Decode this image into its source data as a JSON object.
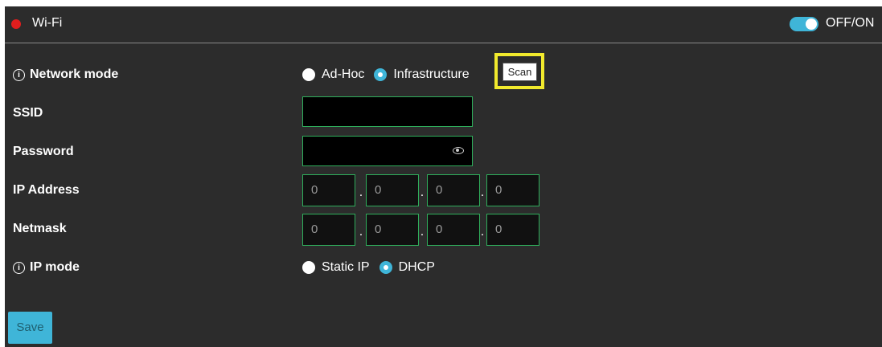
{
  "header": {
    "title": "Wi-Fi",
    "toggle_label": "OFF/ON",
    "toggle_on": true,
    "status_color": "#e01e1e",
    "accent_color": "#3fb5d8"
  },
  "network_mode": {
    "label": "Network mode",
    "info_icon": "i",
    "options": [
      "Ad-Hoc",
      "Infrastructure"
    ],
    "selected": "Infrastructure",
    "scan_label": "Scan"
  },
  "ssid": {
    "label": "SSID",
    "value": ""
  },
  "password": {
    "label": "Password",
    "value": ""
  },
  "ip_address": {
    "label": "IP Address",
    "octets": [
      "0",
      "0",
      "0",
      "0"
    ]
  },
  "netmask": {
    "label": "Netmask",
    "octets": [
      "0",
      "0",
      "0",
      "0"
    ]
  },
  "ip_mode": {
    "label": "IP mode",
    "info_icon": "i",
    "options": [
      "Static IP",
      "DHCP"
    ],
    "selected": "DHCP"
  },
  "save_label": "Save",
  "dot": "."
}
